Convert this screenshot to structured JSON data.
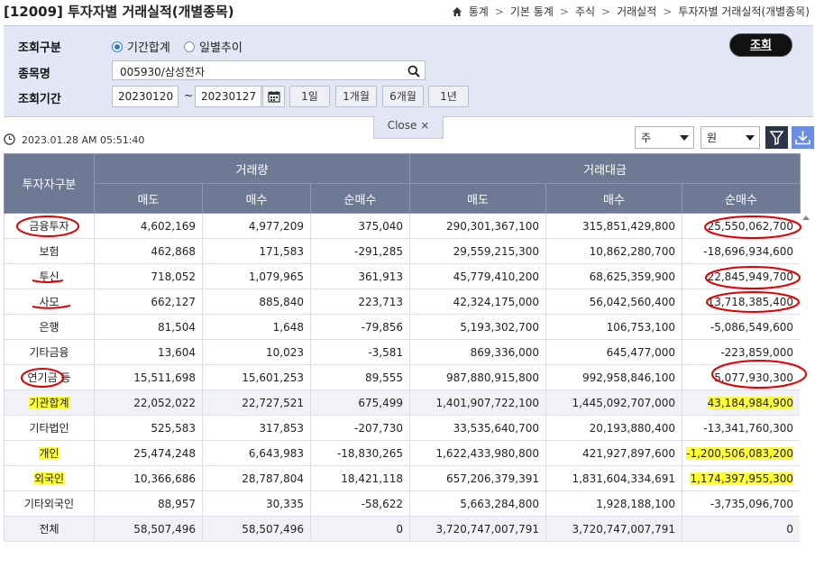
{
  "page": {
    "title": "[12009] 투자자별 거래실적(개별종목)"
  },
  "breadcrumb": {
    "items": [
      "통계",
      "기본 통계",
      "주식",
      "거래실적",
      "투자자별 거래실적(개별종목)"
    ]
  },
  "search": {
    "type_label": "조회구분",
    "radio_period_total": "기간합계",
    "radio_daily_trend": "일별추이",
    "selected_radio": "기간합계",
    "stock_label": "종목명",
    "stock_value": "005930/삼성전자",
    "period_label": "조회기간",
    "date_from": "20230120",
    "date_tilde": "~",
    "date_to": "20230127",
    "period_buttons": [
      "1일",
      "1개월",
      "6개월",
      "1년"
    ],
    "query_button": "조회",
    "close_label": "Close ×"
  },
  "toolbar": {
    "timestamp": "2023.01.28 AM 05:51:40",
    "unit_share": "주",
    "unit_currency": "원"
  },
  "table": {
    "corner_header": "투자자구분",
    "groups": [
      "거래량",
      "거래대금"
    ],
    "sub_headers": [
      "매도",
      "매수",
      "순매수",
      "매도",
      "매수",
      "순매수"
    ],
    "rows": [
      {
        "name": "금융투자",
        "cells": [
          "4,602,169",
          "4,977,209",
          "375,040",
          "290,301,367,100",
          "315,851,429,800",
          "25,550,062,700"
        ]
      },
      {
        "name": "보험",
        "cells": [
          "462,868",
          "171,583",
          "-291,285",
          "29,559,215,300",
          "10,862,280,700",
          "-18,696,934,600"
        ]
      },
      {
        "name": "투신",
        "cells": [
          "718,052",
          "1,079,965",
          "361,913",
          "45,779,410,200",
          "68,625,359,900",
          "22,845,949,700"
        ]
      },
      {
        "name": "사모",
        "cells": [
          "662,127",
          "885,840",
          "223,713",
          "42,324,175,000",
          "56,042,560,400",
          "13,718,385,400"
        ]
      },
      {
        "name": "은행",
        "cells": [
          "81,504",
          "1,648",
          "-79,856",
          "5,193,302,700",
          "106,753,100",
          "-5,086,549,600"
        ]
      },
      {
        "name": "기타금융",
        "cells": [
          "13,604",
          "10,023",
          "-3,581",
          "869,336,000",
          "645,477,000",
          "-223,859,000"
        ]
      },
      {
        "name": "연기금 등",
        "cells": [
          "15,511,698",
          "15,601,253",
          "89,555",
          "987,880,915,800",
          "992,958,846,100",
          "5,077,930,300"
        ]
      },
      {
        "name": "기관합계",
        "cells": [
          "22,052,022",
          "22,727,521",
          "675,499",
          "1,401,907,722,100",
          "1,445,092,707,000",
          "43,184,984,900"
        ]
      },
      {
        "name": "기타법인",
        "cells": [
          "525,583",
          "317,853",
          "-207,730",
          "33,535,640,700",
          "20,193,880,400",
          "-13,341,760,300"
        ]
      },
      {
        "name": "개인",
        "cells": [
          "25,474,248",
          "6,643,983",
          "-18,830,265",
          "1,622,433,980,800",
          "421,927,897,600",
          "-1,200,506,083,200"
        ]
      },
      {
        "name": "외국인",
        "cells": [
          "10,366,686",
          "28,787,804",
          "18,421,118",
          "657,206,379,391",
          "1,831,604,334,691",
          "1,174,397,955,300"
        ]
      },
      {
        "name": "기타외국인",
        "cells": [
          "88,957",
          "30,335",
          "-58,622",
          "5,663,284,800",
          "1,928,188,100",
          "-3,735,096,700"
        ]
      },
      {
        "name": "전체",
        "cells": [
          "58,507,496",
          "58,507,496",
          "0",
          "3,720,747,007,791",
          "3,720,747,007,791",
          "0"
        ]
      }
    ]
  },
  "colors": {
    "panel_bg": "#e3e6f4",
    "header_bg": "#6e7a94",
    "highlight": "#ffff33",
    "annotation": "#e00000"
  },
  "icons": [
    "home-icon",
    "search-icon",
    "calendar-icon",
    "clock-icon",
    "filter-icon",
    "download-icon"
  ]
}
